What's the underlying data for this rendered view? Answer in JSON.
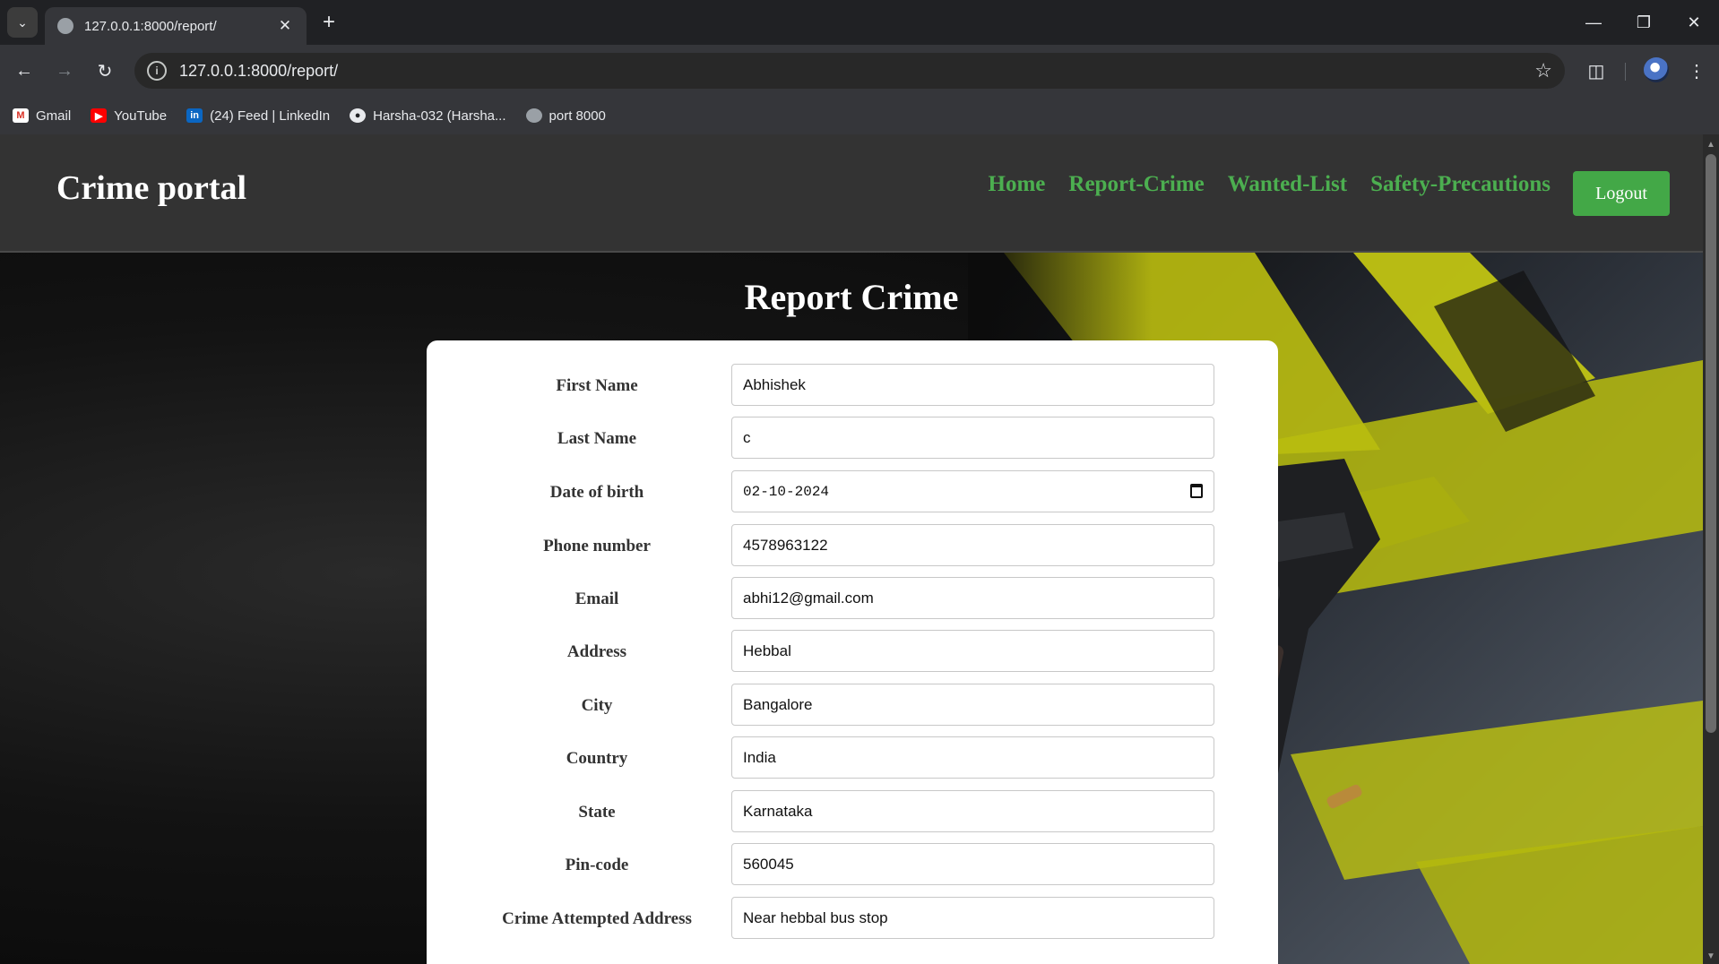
{
  "browser": {
    "tab_title": "127.0.0.1:8000/report/",
    "url": "127.0.0.1:8000/report/",
    "bookmarks": [
      {
        "label": "Gmail",
        "icon": "gmail-icon"
      },
      {
        "label": "YouTube",
        "icon": "youtube-icon"
      },
      {
        "label": "(24) Feed | LinkedIn",
        "icon": "linkedin-icon"
      },
      {
        "label": "Harsha-032 (Harsha...",
        "icon": "github-icon"
      },
      {
        "label": "port 8000",
        "icon": "globe-icon"
      }
    ]
  },
  "site": {
    "brand": "Crime portal",
    "nav": [
      "Home",
      "Report-Crime",
      "Wanted-List",
      "Safety-Precautions"
    ],
    "logout_label": "Logout",
    "accent_color": "#4caf50"
  },
  "page": {
    "title": "Report Crime"
  },
  "form": {
    "fields": [
      {
        "label": "First Name",
        "value": "Abhishek"
      },
      {
        "label": "Last Name",
        "value": "c"
      },
      {
        "label": "Date of birth",
        "value": "02-10-2024"
      },
      {
        "label": "Phone number",
        "value": "4578963122"
      },
      {
        "label": "Email",
        "value": "abhi12@gmail.com"
      },
      {
        "label": "Address",
        "value": "Hebbal"
      },
      {
        "label": "City",
        "value": "Bangalore"
      },
      {
        "label": "Country",
        "value": "India"
      },
      {
        "label": "State",
        "value": "Karnataka"
      },
      {
        "label": "Pin-code",
        "value": "560045"
      },
      {
        "label": "Crime Attempted Address",
        "value": "Near hebbal bus stop"
      }
    ]
  }
}
